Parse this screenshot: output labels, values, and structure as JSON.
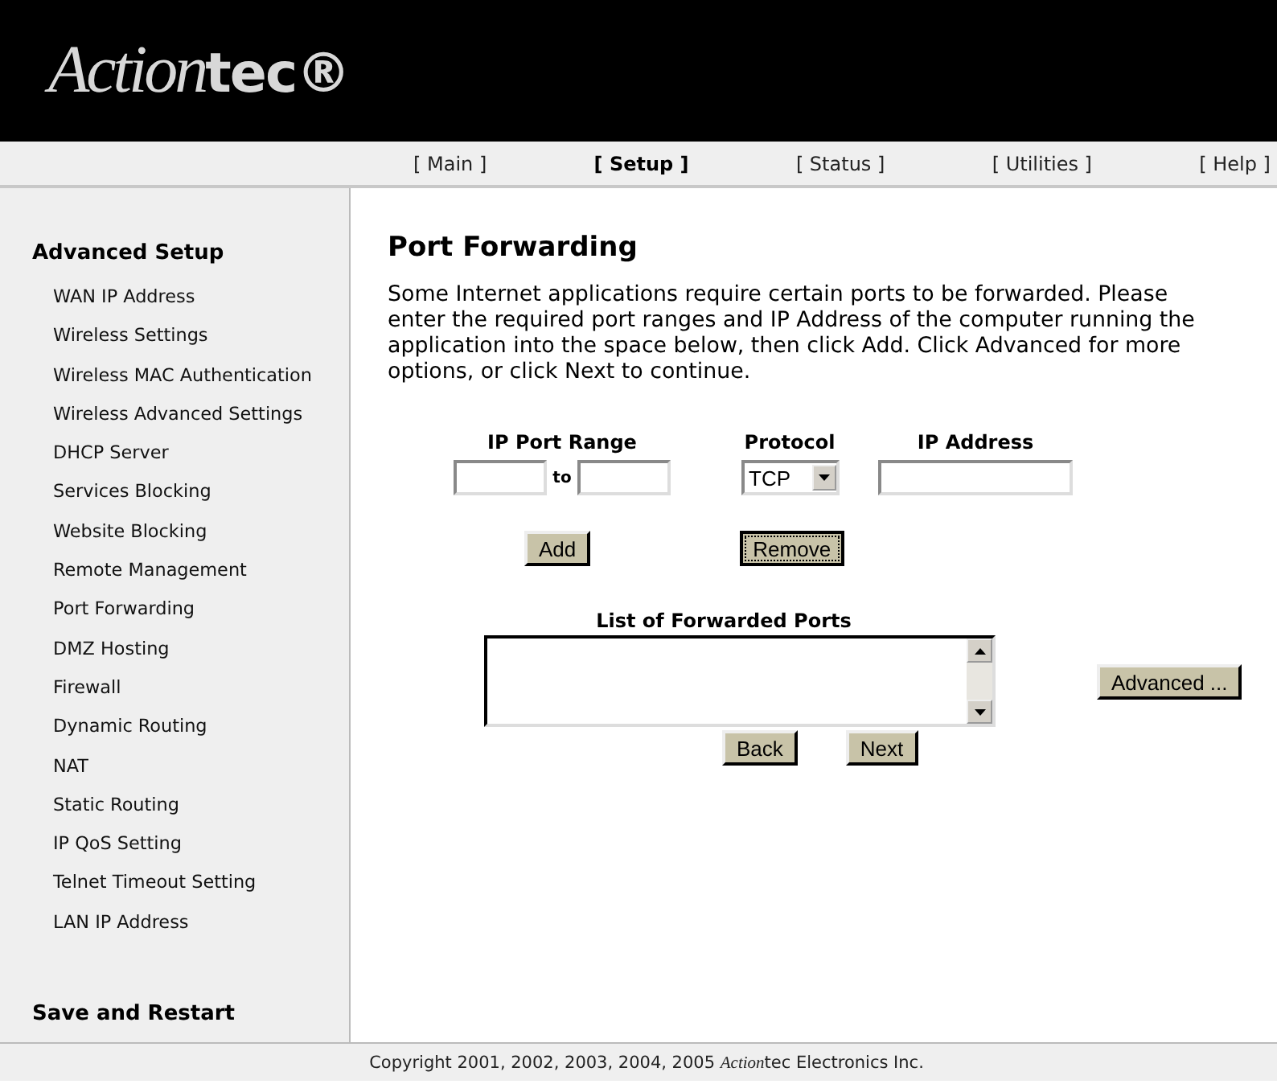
{
  "logo": [
    {
      "text": "Action",
      "italic": true
    },
    {
      "text": "tec®",
      "italic": false
    }
  ],
  "nav": [
    {
      "label": "[ Main ]",
      "selected": false
    },
    {
      "label": "[ Setup ]",
      "selected": true
    },
    {
      "label": "[ Status ]",
      "selected": false
    },
    {
      "label": "[ Utilities ]",
      "selected": false
    },
    {
      "label": "[ Help ]",
      "selected": false
    }
  ],
  "sidebar": {
    "heading": "Advanced Setup",
    "items": [
      "WAN IP Address",
      "Wireless Settings",
      "Wireless MAC Authentication",
      "Wireless Advanced Settings",
      "DHCP Server",
      "Services Blocking",
      "Website Blocking",
      "Remote Management",
      "Port Forwarding",
      "DMZ Hosting",
      "Firewall",
      "Dynamic Routing",
      "NAT",
      "Static Routing",
      "IP QoS Setting",
      "Telnet Timeout Setting",
      "LAN IP Address"
    ],
    "footer_heading": "Save and Restart"
  },
  "page_title": "Port Forwarding",
  "intro": "Some Internet applications require certain ports to be forwarded. Please enter the required port ranges and IP Address of the computer running the application into the space below, then click Add. Click Advanced for more options, or click Next to continue.",
  "port_range": {
    "label": "IP Port Range",
    "joiner": "to"
  },
  "protocol": {
    "label": "Protocol",
    "value": "TCP"
  },
  "ip_address": {
    "label": "IP Address"
  },
  "action_buttons": [
    {
      "label": "Add",
      "focused": false
    },
    {
      "label": "Remove",
      "focused": true
    }
  ],
  "forwarded_list": {
    "title": "List of Forwarded Ports"
  },
  "advanced_button": {
    "label": "Advanced ..."
  },
  "nav_buttons": [
    {
      "label": "Back"
    },
    {
      "label": "Next"
    }
  ],
  "footer": [
    {
      "text": "Copyright 2001, 2002, 2003, 2004, 2005 ",
      "italic": false
    },
    {
      "text": "Action",
      "italic": true
    },
    {
      "text": "tec Electronics Inc.",
      "italic": false
    }
  ]
}
